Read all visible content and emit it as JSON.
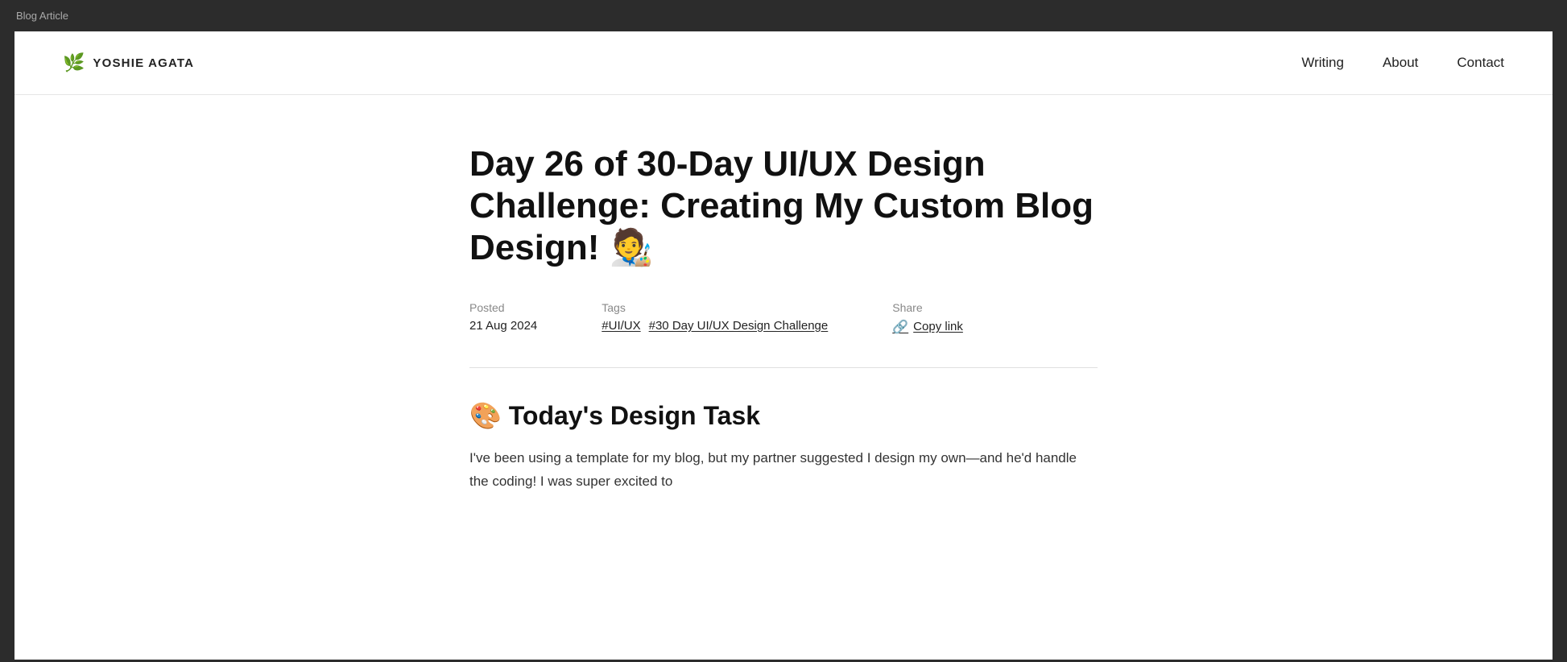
{
  "browser": {
    "title": "Blog Article"
  },
  "header": {
    "logo_icon": "🌿",
    "site_name": "YOSHIE AGATA",
    "nav": [
      {
        "label": "Writing",
        "href": "#"
      },
      {
        "label": "About",
        "href": "#"
      },
      {
        "label": "Contact",
        "href": "#"
      }
    ]
  },
  "article": {
    "title": "Day 26 of 30-Day UI/UX Design Challenge: Creating My Custom Blog Design! 🧑‍🎨",
    "meta": {
      "posted_label": "Posted",
      "posted_date": "21 Aug 2024",
      "tags_label": "Tags",
      "tags": [
        {
          "label": "#UI/UX",
          "href": "#"
        },
        {
          "label": "#30 Day UI/UX Design Challenge",
          "href": "#"
        }
      ],
      "share_label": "Share",
      "copy_link_label": "Copy link"
    },
    "section_heading": "🎨 Today's Design Task",
    "body_text": "I've been using a template for my blog, but my partner suggested I design my own—and he'd handle the coding! I was super excited to"
  }
}
